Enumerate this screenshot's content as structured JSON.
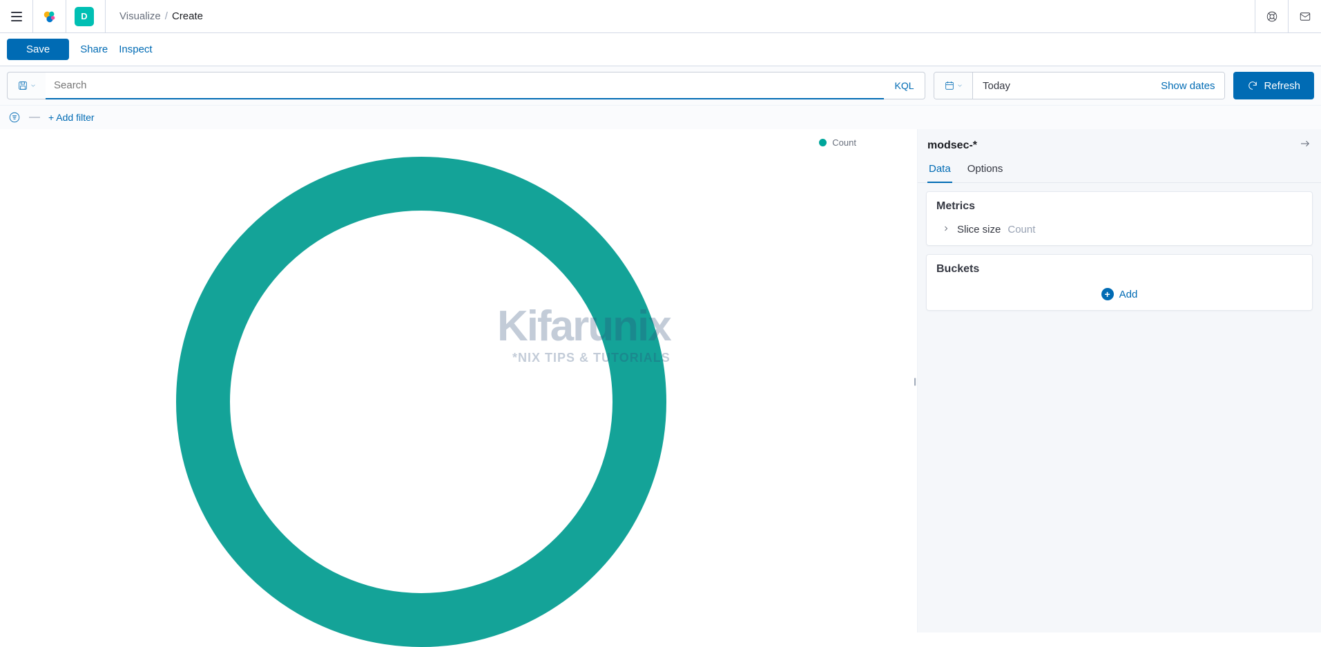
{
  "header": {
    "space_letter": "D",
    "breadcrumbs": {
      "parent": "Visualize",
      "current": "Create"
    }
  },
  "action_bar": {
    "save": "Save",
    "share": "Share",
    "inspect": "Inspect"
  },
  "search": {
    "placeholder": "Search",
    "value": "",
    "language_badge": "KQL"
  },
  "time_picker": {
    "quick_label": "Today",
    "show_dates_label": "Show dates"
  },
  "refresh_label": "Refresh",
  "add_filter_label": "+ Add filter",
  "legend": {
    "label": "Count",
    "color": "#00a69b"
  },
  "sidebar": {
    "index_pattern": "modsec-*",
    "tabs": [
      "Data",
      "Options"
    ],
    "active_tab": "Data",
    "metrics": {
      "title": "Metrics",
      "item_label": "Slice size",
      "item_value": "Count"
    },
    "buckets": {
      "title": "Buckets",
      "add_label": "Add"
    }
  },
  "chart_data": {
    "type": "pie",
    "title": "",
    "series": [
      {
        "name": "Count",
        "value": 1,
        "color": "#14a398"
      }
    ],
    "donut": true,
    "legend_position": "right"
  },
  "watermark": {
    "brand": "Kifarunix",
    "tag": "*NIX TIPS & TUTORIALS"
  }
}
